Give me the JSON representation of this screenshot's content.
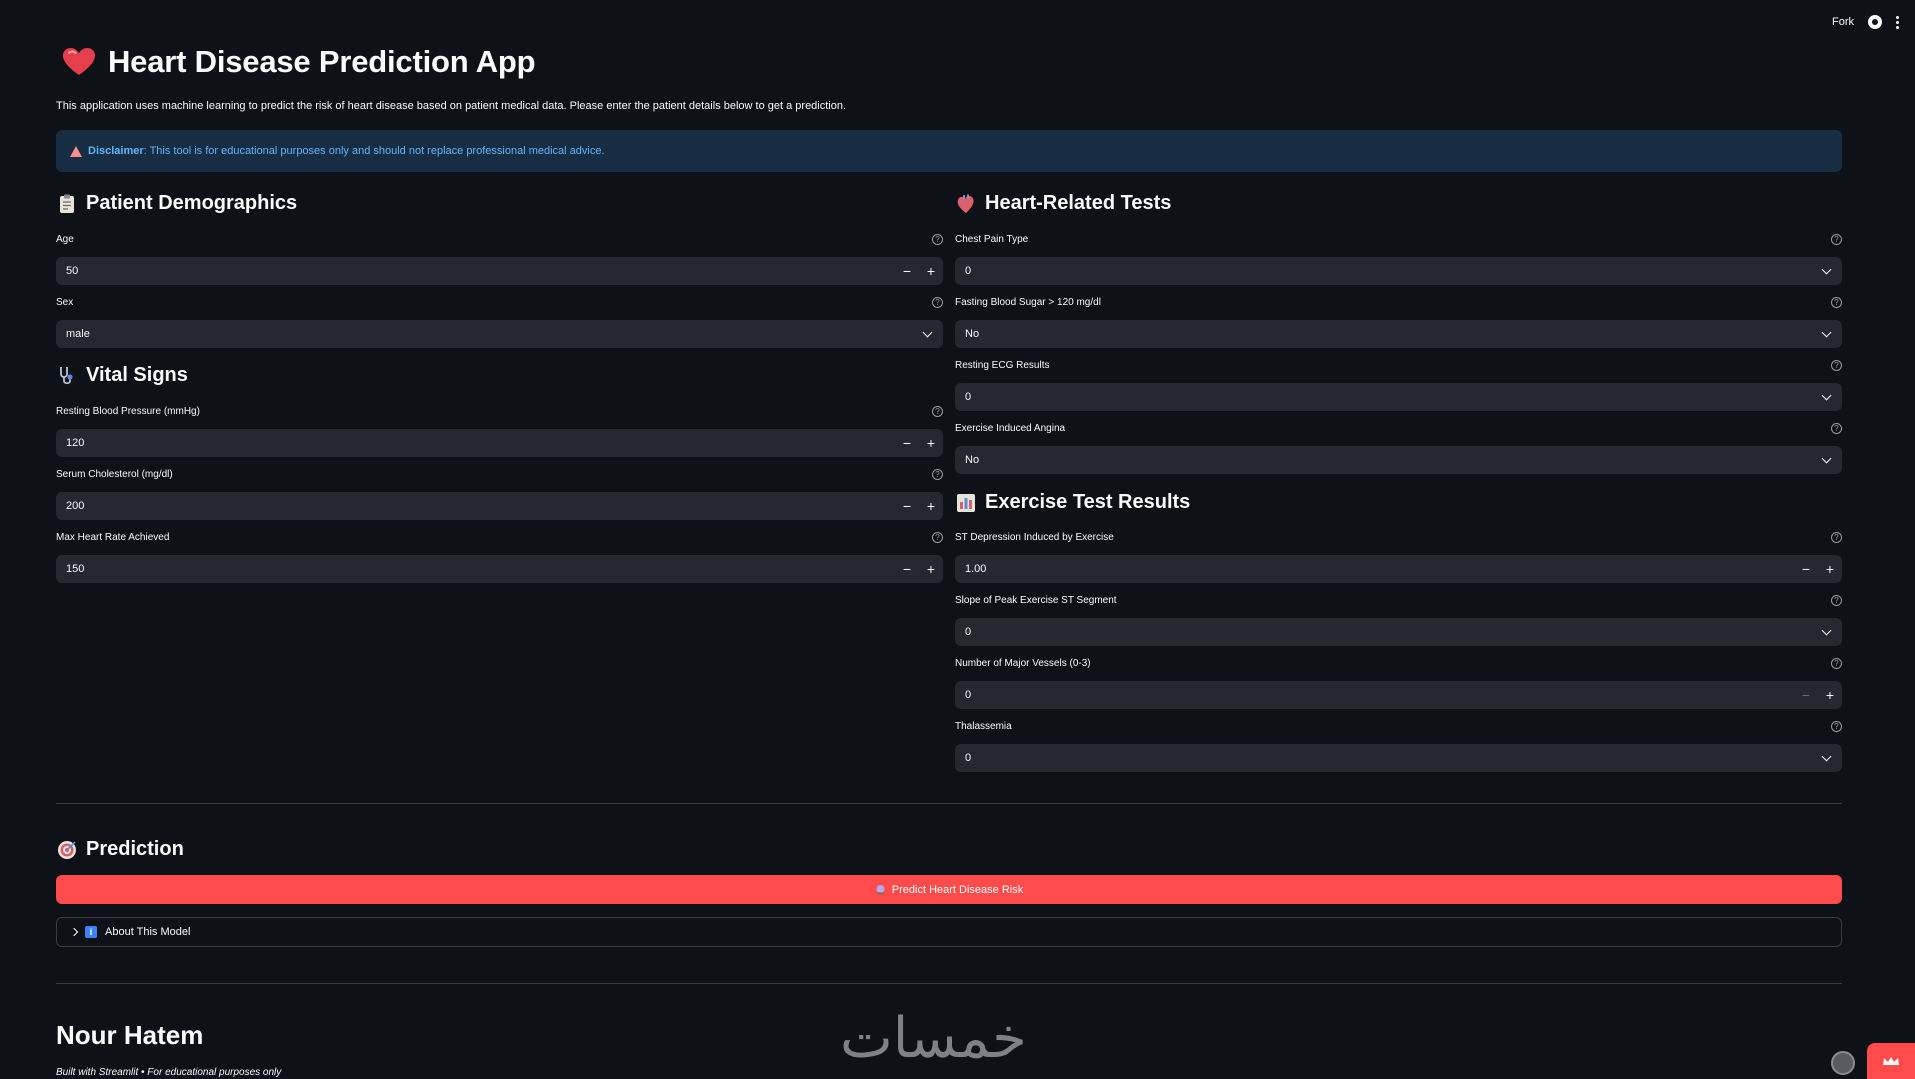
{
  "topbar": {
    "fork_label": "Fork"
  },
  "header": {
    "title": "Heart Disease Prediction App",
    "intro": "This application uses machine learning to predict the risk of heart disease based on patient medical data. Please enter the patient details below to get a prediction.",
    "disclaimer_bold": "Disclaimer",
    "disclaimer_text": ": This tool is for educational purposes only and should not replace professional medical advice."
  },
  "demographics": {
    "title": "Patient Demographics",
    "age": {
      "label": "Age",
      "value": "50"
    },
    "sex": {
      "label": "Sex",
      "value": "male"
    }
  },
  "vitals": {
    "title": "Vital Signs",
    "bp": {
      "label": "Resting Blood Pressure (mmHg)",
      "value": "120"
    },
    "chol": {
      "label": "Serum Cholesterol (mg/dl)",
      "value": "200"
    },
    "hr": {
      "label": "Max Heart Rate Achieved",
      "value": "150"
    }
  },
  "heart_tests": {
    "title": "Heart-Related Tests",
    "cp": {
      "label": "Chest Pain Type",
      "value": "0"
    },
    "fbs": {
      "label": "Fasting Blood Sugar > 120 mg/dl",
      "value": "No"
    },
    "ecg": {
      "label": "Resting ECG Results",
      "value": "0"
    },
    "angina": {
      "label": "Exercise Induced Angina",
      "value": "No"
    }
  },
  "exercise": {
    "title": "Exercise Test Results",
    "st": {
      "label": "ST Depression Induced by Exercise",
      "value": "1.00"
    },
    "slope": {
      "label": "Slope of Peak Exercise ST Segment",
      "value": "0"
    },
    "vessels": {
      "label": "Number of Major Vessels (0-3)",
      "value": "0"
    },
    "thal": {
      "label": "Thalassemia",
      "value": "0"
    }
  },
  "prediction": {
    "title": "Prediction",
    "button_label": "Predict Heart Disease Risk",
    "expander_label": "About This Model"
  },
  "footer": {
    "author": "Nour Hatem",
    "built_with": "Built with Streamlit • For educational purposes only",
    "watermark": "خمسات"
  },
  "glyphs": {
    "help": "?",
    "minus": "−",
    "plus": "+",
    "info": "i"
  },
  "colors": {
    "background": "#0e1117",
    "input": "#262730",
    "accent": "#ff4b4b",
    "info_bg": "#172d43",
    "info_text": "#60b4ff"
  }
}
